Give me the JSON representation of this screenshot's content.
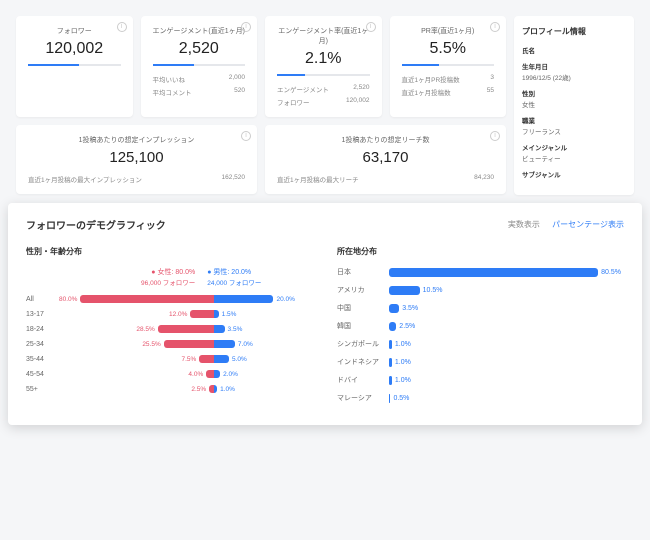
{
  "metrics": [
    {
      "label": "フォロワー",
      "value": "120,002",
      "bar": 55,
      "subs": []
    },
    {
      "label": "エンゲージメント(直近1ヶ月)",
      "value": "2,520",
      "bar": 45,
      "subs": [
        [
          "平均いいね",
          "2,000"
        ],
        [
          "平均コメント",
          "520"
        ]
      ]
    },
    {
      "label": "エンゲージメント率(直近1ヶ月)",
      "value": "2.1%",
      "bar": 30,
      "subs": [
        [
          "エンゲージメント",
          "2,520"
        ],
        [
          "フォロワー",
          "120,002"
        ]
      ]
    },
    {
      "label": "PR率(直近1ヶ月)",
      "value": "5.5%",
      "bar": 40,
      "subs": [
        [
          "直近1ヶ月PR投稿数",
          "3"
        ],
        [
          "直近1ヶ月投稿数",
          "55"
        ]
      ]
    }
  ],
  "wide": [
    {
      "label": "1投稿あたりの想定インプレッション",
      "value": "125,100",
      "sub": [
        "直近1ヶ月投稿の最大インプレッション",
        "162,520"
      ]
    },
    {
      "label": "1投稿あたりの想定リーチ数",
      "value": "63,170",
      "sub": [
        "直近1ヶ月投稿の最大リーチ",
        "84,230"
      ]
    }
  ],
  "profile": {
    "heading": "プロフィール情報",
    "items": [
      [
        "氏名",
        ""
      ],
      [
        "生年月日",
        "1996/12/5 (22歳)"
      ],
      [
        "性別",
        "女性"
      ],
      [
        "職業",
        "フリーランス"
      ],
      [
        "メインジャンル",
        "ビューティー"
      ],
      [
        "サブジャンル",
        ""
      ]
    ]
  },
  "demo": {
    "title": "フォロワーのデモグラフィック",
    "toggle": [
      "実数表示",
      "パーセンテージ表示"
    ],
    "age": {
      "heading": "性別・年齢分布",
      "female_label": "女性: 80.0%",
      "female_sub": "96,000 フォロワー",
      "male_label": "男性: 20.0%",
      "male_sub": "24,000 フォロワー"
    },
    "loc_heading": "所在地分布"
  },
  "chart_data": [
    {
      "type": "bar",
      "subtype": "diverging",
      "title": "性別・年齢分布",
      "categories": [
        "All",
        "13-17",
        "18-24",
        "25-34",
        "35-44",
        "45-54",
        "55+"
      ],
      "series": [
        {
          "name": "女性",
          "pct": [
            80.0,
            12.0,
            28.5,
            25.5,
            7.5,
            4.0,
            2.5
          ]
        },
        {
          "name": "男性",
          "pct": [
            20.0,
            1.5,
            3.5,
            7.0,
            5.0,
            2.0,
            1.0
          ]
        }
      ],
      "totals": {
        "female_followers": 96000,
        "male_followers": 24000
      }
    },
    {
      "type": "bar",
      "title": "所在地分布",
      "categories": [
        "日本",
        "アメリカ",
        "中国",
        "韓国",
        "シンガポール",
        "インドネシア",
        "ドバイ",
        "マレーシア"
      ],
      "values": [
        80.5,
        10.5,
        3.5,
        2.5,
        1.0,
        1.0,
        1.0,
        0.5
      ]
    }
  ]
}
